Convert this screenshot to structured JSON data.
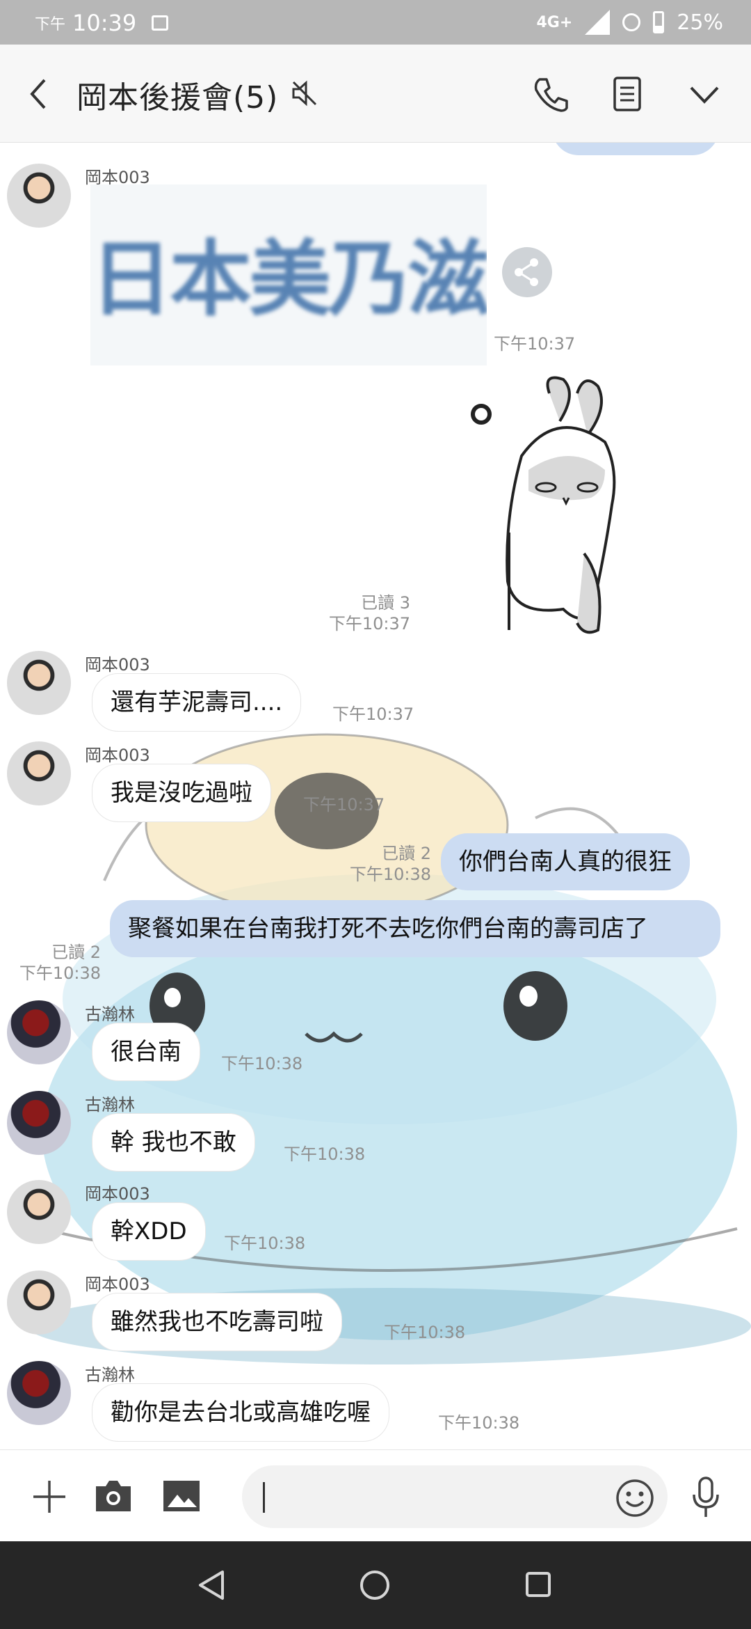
{
  "status_bar": {
    "ampm": "下午",
    "time": "10:39",
    "network": "4G+",
    "battery": "25%"
  },
  "header": {
    "title": "岡本後援會(5)"
  },
  "chat": {
    "image_message": {
      "text": "日本美乃滋",
      "time": "下午10:37"
    },
    "sticker": {
      "read": "已讀 3",
      "time": "下午10:37"
    },
    "messages": [
      {
        "sender": "岡本003",
        "text": "還有芋泥壽司....",
        "time": "下午10:37"
      },
      {
        "sender": "岡本003",
        "text": "我是沒吃過啦",
        "time": "下午10:37"
      },
      {
        "text": "你們台南人真的很狂",
        "read": "已讀 2",
        "time": "下午10:38"
      },
      {
        "text": "聚餐如果在台南我打死不去吃你們台南的壽司店了",
        "read": "已讀 2",
        "time": "下午10:38"
      },
      {
        "sender": "古瀚林",
        "text": "很台南",
        "time": "下午10:38"
      },
      {
        "sender": "古瀚林",
        "text": "幹 我也不敢",
        "time": "下午10:38"
      },
      {
        "sender": "岡本003",
        "text": "幹XDD",
        "time": "下午10:38"
      },
      {
        "sender": "岡本003",
        "text": "雖然我也不吃壽司啦",
        "time": "下午10:38"
      },
      {
        "sender": "古瀚林",
        "text": "勸你是去台北或高雄吃喔",
        "time": "下午10:38"
      }
    ],
    "top_sender": "岡本003"
  },
  "input": {
    "value": "",
    "placeholder": ""
  },
  "colors": {
    "outgoing_bubble": "#ccdcf2",
    "header_bg": "#f7f7f7",
    "status_bar_bg": "#b7b7b7",
    "nav_bar_bg": "#262626"
  }
}
